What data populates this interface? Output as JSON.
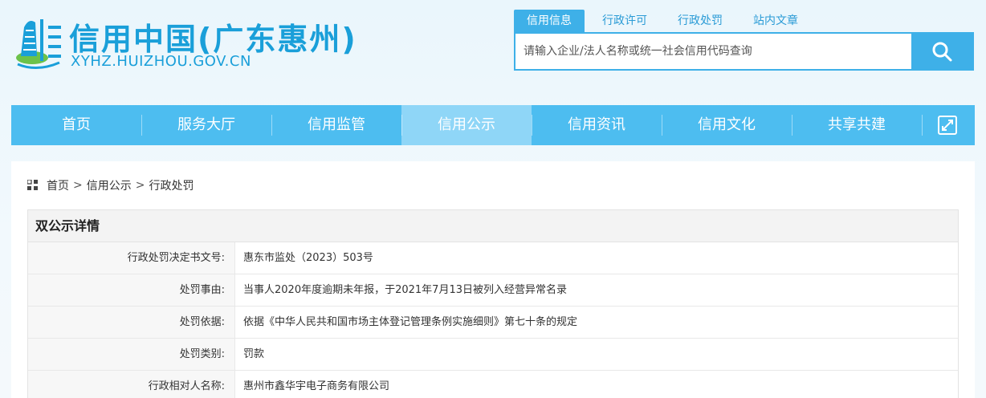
{
  "header": {
    "site_title": "信用中国(广东惠州)",
    "site_domain": "XYHZ.HUIZHOU.GOV.CN"
  },
  "search": {
    "tabs": [
      {
        "label": "信用信息",
        "active": true
      },
      {
        "label": "行政许可",
        "active": false
      },
      {
        "label": "行政处罚",
        "active": false
      },
      {
        "label": "站内文章",
        "active": false
      }
    ],
    "placeholder": "请输入企业/法人名称或统一社会信用代码查询",
    "button_icon": "search-icon"
  },
  "nav": {
    "items": [
      {
        "label": "首页"
      },
      {
        "label": "服务大厅"
      },
      {
        "label": "信用监管"
      },
      {
        "label": "信用公示",
        "active": true
      },
      {
        "label": "信用资讯"
      },
      {
        "label": "信用文化"
      },
      {
        "label": "共享共建"
      }
    ],
    "expand_icon": "expand-icon"
  },
  "breadcrumb": {
    "icon": "grid-icon",
    "items": [
      "首页",
      "信用公示",
      "行政处罚"
    ],
    "separator": ">"
  },
  "detail": {
    "title": "双公示详情",
    "rows": [
      {
        "label": "行政处罚决定书文号:",
        "value": "惠东市监处（2023）503号"
      },
      {
        "label": "处罚事由:",
        "value": "当事人2020年度逾期未年报，于2021年7月13日被列入经营异常名录"
      },
      {
        "label": "处罚依据:",
        "value": "依据《中华人民共和国市场主体登记管理条例实施细则》第七十条的规定"
      },
      {
        "label": "处罚类别:",
        "value": "罚款"
      },
      {
        "label": "行政相对人名称:",
        "value": "惠州市鑫华宇电子商务有限公司"
      }
    ]
  },
  "colors": {
    "brand": "#1a9fd9",
    "nav_bg": "#4dbdf0",
    "nav_active": "#8fd6f7",
    "search_accent": "#3eb0e8"
  }
}
